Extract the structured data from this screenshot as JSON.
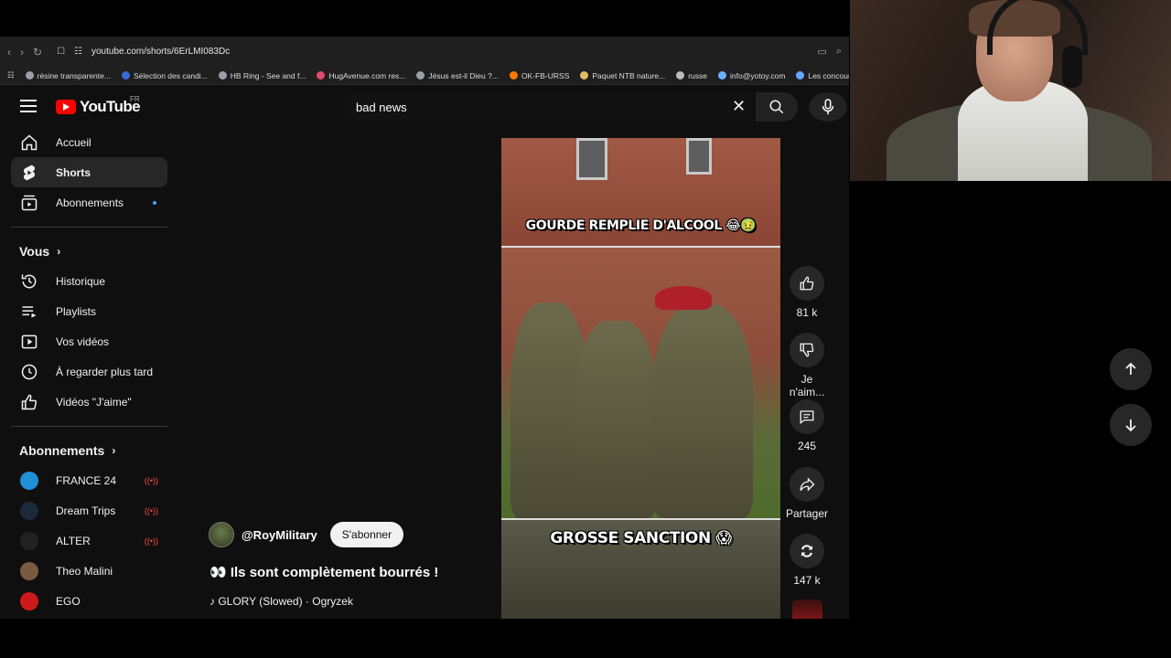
{
  "browser": {
    "url": "youtube.com/shorts/6ErLMI083Dc",
    "bookmarks": [
      {
        "label": "résine transparente...",
        "color": "#9aa0a6"
      },
      {
        "label": "Sélection des candi...",
        "color": "#3b6bd6"
      },
      {
        "label": "HB Ring - See and f...",
        "color": "#9aa0a6"
      },
      {
        "label": "HugAvenue.com res...",
        "color": "#e24a6b"
      },
      {
        "label": "Jésus est-il Dieu ?...",
        "color": "#9aa0a6"
      },
      {
        "label": "OK-FB-URSS",
        "color": "#ff7a00"
      },
      {
        "label": "Paquet NTB nature...",
        "color": "#e0c060"
      },
      {
        "label": "russe",
        "color": "#bbbbbb"
      },
      {
        "label": "info@yotoy.com",
        "color": "#6ab0ff"
      },
      {
        "label": "Les concours d'a",
        "color": "#6aa6ff"
      }
    ]
  },
  "youtube": {
    "logo_text": "YouTube",
    "region": "FR",
    "search_value": "bad news",
    "sidebar": {
      "main": [
        {
          "label": "Accueil",
          "icon": "home-icon",
          "active": false
        },
        {
          "label": "Shorts",
          "icon": "shorts-icon",
          "active": true
        },
        {
          "label": "Abonnements",
          "icon": "subscriptions-icon",
          "active": false
        }
      ],
      "you_heading": "Vous",
      "you": [
        {
          "label": "Historique",
          "icon": "history-icon"
        },
        {
          "label": "Playlists",
          "icon": "playlists-icon"
        },
        {
          "label": "Vos vidéos",
          "icon": "your-videos-icon"
        },
        {
          "label": "À regarder plus tard",
          "icon": "watch-later-icon"
        },
        {
          "label": "Vidéos \"J'aime\"",
          "icon": "liked-icon"
        }
      ],
      "subs_heading": "Abonnements",
      "subs": [
        {
          "label": "FRANCE 24",
          "color": "#1f8fd6",
          "live": true
        },
        {
          "label": "Dream Trips",
          "color": "#1a2a3a",
          "live": true
        },
        {
          "label": "ALTER",
          "color": "#222222",
          "live": true
        },
        {
          "label": "Theo Malini",
          "color": "#7a5a40",
          "live": false
        },
        {
          "label": "EGO",
          "color": "#cc1a1a",
          "live": false
        }
      ]
    },
    "short": {
      "caption_top": "GOURDE REMPLIE D'ALCOOL 😂🤢",
      "caption_bottom": "GROSSE SANCTION 😱",
      "channel": "@RoyMilitary",
      "subscribe": "S'abonner",
      "title": "👀 Ils sont complètement bourrés !",
      "sound": "♪ GLORY (Slowed) · Ogryzek",
      "actions": {
        "likes": "81 k",
        "dislike": "Je n'aim...",
        "comments": "245",
        "share": "Partager",
        "remix": "147 k"
      }
    }
  }
}
